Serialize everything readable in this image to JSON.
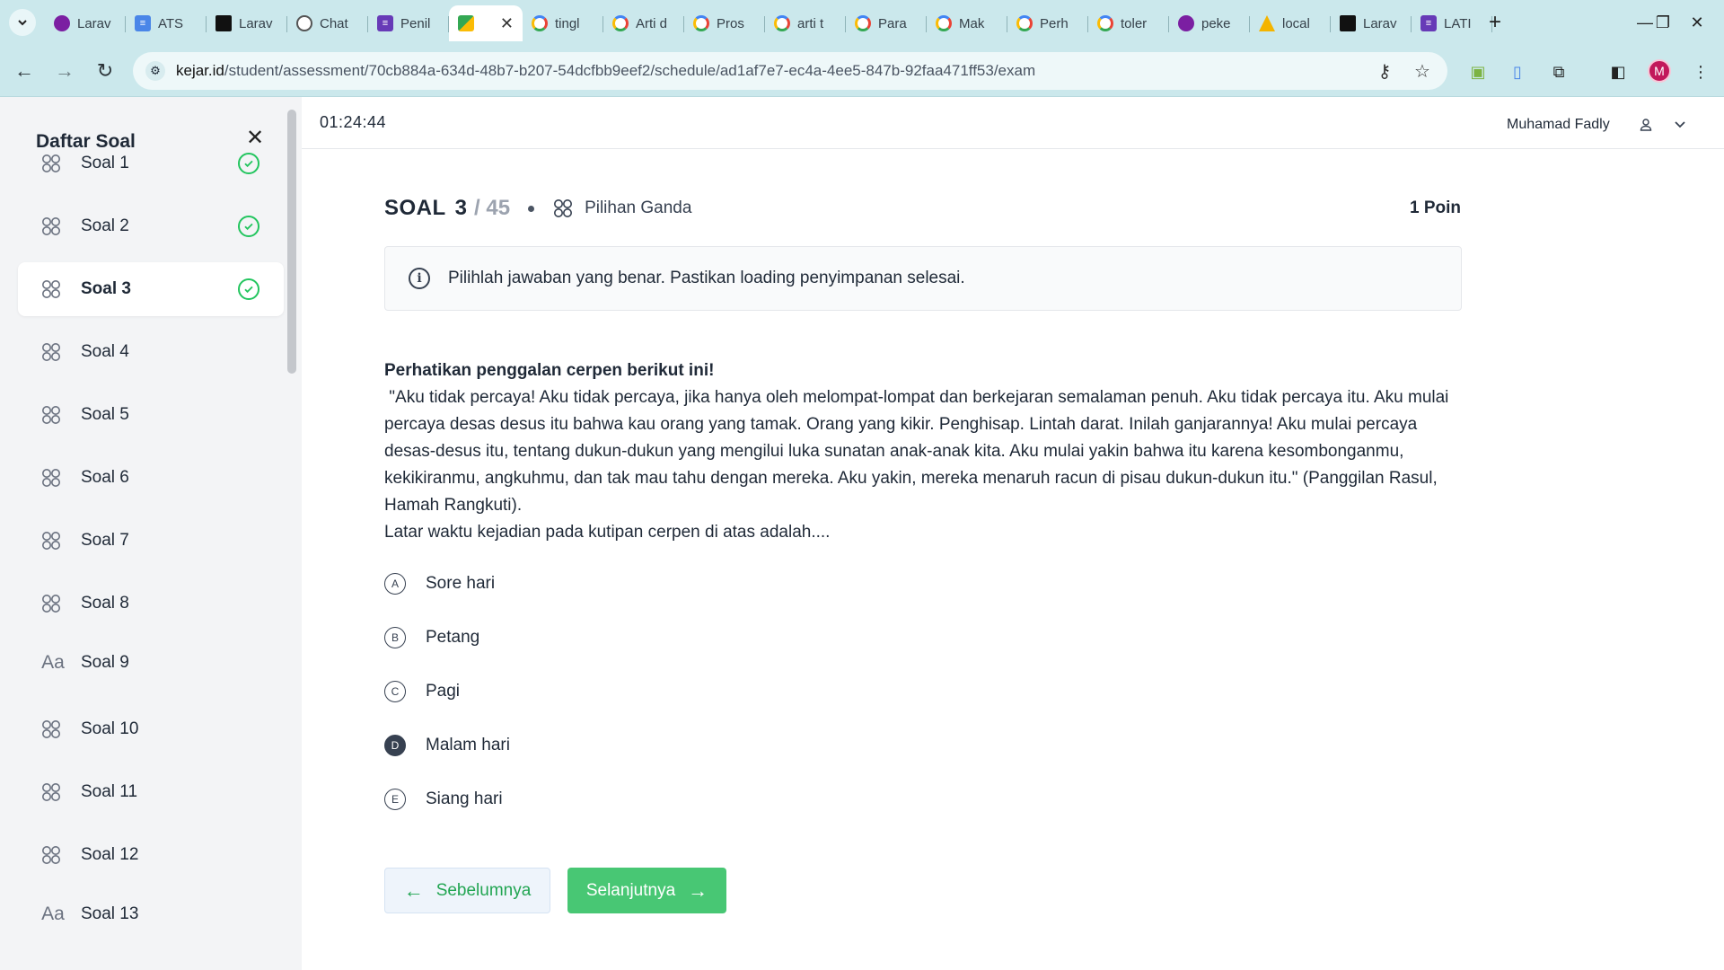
{
  "browser": {
    "tabs": [
      {
        "label": "Larav",
        "icon": "purple-circle-favicon",
        "active": false
      },
      {
        "label": "ATS",
        "icon": "docs-favicon",
        "active": false
      },
      {
        "label": "Larav",
        "icon": "dev-favicon",
        "active": false
      },
      {
        "label": "Chat",
        "icon": "chatgpt-favicon",
        "active": false
      },
      {
        "label": "Penil",
        "icon": "forms-favicon",
        "active": false
      },
      {
        "label": "",
        "icon": "meet-favicon",
        "active": true
      },
      {
        "label": "tingl",
        "icon": "google-favicon",
        "active": false
      },
      {
        "label": "Arti d",
        "icon": "google-favicon",
        "active": false
      },
      {
        "label": "Pros",
        "icon": "google-favicon",
        "active": false
      },
      {
        "label": "arti t",
        "icon": "google-favicon",
        "active": false
      },
      {
        "label": "Para",
        "icon": "google-favicon",
        "active": false
      },
      {
        "label": "Mak",
        "icon": "google-favicon",
        "active": false
      },
      {
        "label": "Perh",
        "icon": "google-favicon",
        "active": false
      },
      {
        "label": "toler",
        "icon": "google-favicon",
        "active": false
      },
      {
        "label": "peke",
        "icon": "purple-circle-favicon",
        "active": false
      },
      {
        "label": "local",
        "icon": "local-favicon",
        "active": false
      },
      {
        "label": "Larav",
        "icon": "dev-favicon",
        "active": false
      },
      {
        "label": "LATI",
        "icon": "forms-favicon",
        "active": false
      }
    ],
    "url_host": "kejar.id",
    "url_path": "/student/assessment/70cb884a-634d-48b7-b207-54dcfbb9eef2/schedule/ad1af7e7-ec4a-4ee5-847b-92faa471ff53/exam",
    "profile_initial": "M"
  },
  "sidebar": {
    "title": "Daftar Soal",
    "items": [
      {
        "label": "Soal 1",
        "icon": "grid-icon",
        "answered": true
      },
      {
        "label": "Soal 2",
        "icon": "grid-icon",
        "answered": true
      },
      {
        "label": "Soal 3",
        "icon": "grid-icon",
        "answered": true,
        "active": true
      },
      {
        "label": "Soal 4",
        "icon": "grid-icon",
        "answered": false
      },
      {
        "label": "Soal 5",
        "icon": "grid-icon",
        "answered": false
      },
      {
        "label": "Soal 6",
        "icon": "grid-icon",
        "answered": false
      },
      {
        "label": "Soal 7",
        "icon": "grid-icon",
        "answered": false
      },
      {
        "label": "Soal 8",
        "icon": "grid-icon",
        "answered": false
      },
      {
        "label": "Soal 9",
        "icon": "text-icon",
        "icon_text": "Aa",
        "answered": false
      },
      {
        "label": "Soal 10",
        "icon": "grid-icon",
        "answered": false
      },
      {
        "label": "Soal 11",
        "icon": "grid-icon",
        "answered": false
      },
      {
        "label": "Soal 12",
        "icon": "grid-icon",
        "answered": false
      },
      {
        "label": "Soal 13",
        "icon": "text-icon",
        "icon_text": "Aa",
        "answered": false
      }
    ]
  },
  "header": {
    "timer": "01:24:44",
    "user_name": "Muhamad Fadly"
  },
  "question": {
    "label": "SOAL",
    "number": "3",
    "total": "/ 45",
    "type": "Pilihan Ganda",
    "points": "1 Poin",
    "info": "Pilihlah jawaban yang benar. Pastikan loading penyimpanan selesai.",
    "intro": "Perhatikan penggalan cerpen berikut ini!",
    "passage": " \"Aku tidak percaya! Aku tidak percaya, jika hanya oleh melompat-lompat dan berkejaran semalaman penuh. Aku tidak percaya itu. Aku mulai percaya desas desus itu bahwa kau orang yang tamak. Orang yang kikir. Penghisap. Lintah darat. Inilah ganjarannya! Aku mulai percaya desas-desus itu, tentang dukun-dukun yang mengilui luka sunatan anak-anak kita. Aku mulai yakin bahwa itu karena kesombonganmu, kekikiranmu, angkuhmu, dan tak mau tahu dengan mereka. Aku yakin, mereka menaruh racun di pisau dukun-dukun itu.\" (Panggilan Rasul, Hamah Rangkuti).",
    "prompt": "Latar waktu kejadian pada kutipan cerpen di atas adalah....",
    "options": [
      {
        "key": "A",
        "text": "Sore hari",
        "selected": false
      },
      {
        "key": "B",
        "text": "Petang",
        "selected": false
      },
      {
        "key": "C",
        "text": "Pagi",
        "selected": false
      },
      {
        "key": "D",
        "text": "Malam hari",
        "selected": true
      },
      {
        "key": "E",
        "text": "Siang hari",
        "selected": false
      }
    ]
  },
  "navigation": {
    "prev_label": "Sebelumnya",
    "next_label": "Selanjutnya"
  },
  "colors": {
    "accent_green": "#48c774",
    "check_green": "#22c55e",
    "chrome_teal": "#cbe8ec"
  }
}
